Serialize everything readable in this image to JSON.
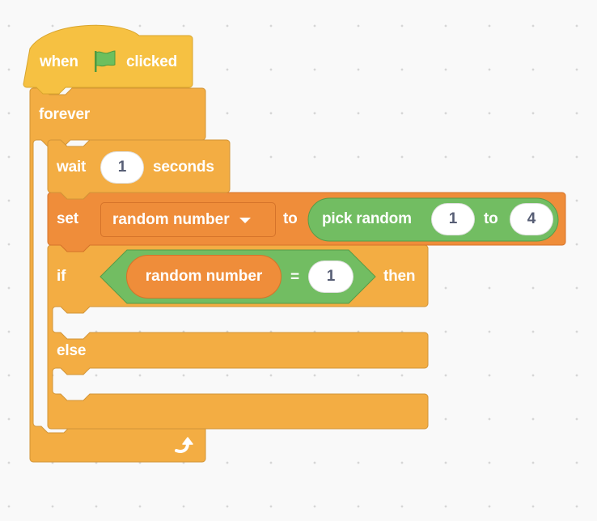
{
  "colors": {
    "events": "#f6c142",
    "events_border": "#d9a52c",
    "control": "#f3ad43",
    "control_border": "#d29538",
    "variables": "#ef8d3a",
    "variables_border": "#d5732a",
    "operators": "#72bd62",
    "operators_border": "#579c48",
    "input_text": "#575e75",
    "flag": "#6cbf5e"
  },
  "script": {
    "hat": {
      "label_before": "when",
      "icon": "green-flag-icon",
      "label_after": "clicked"
    },
    "forever": {
      "label": "forever",
      "end_icon": "repeat-arrow-icon"
    },
    "wait": {
      "label_before": "wait",
      "value": "1",
      "label_after": "seconds"
    },
    "set": {
      "label": "set",
      "variable": "random number",
      "to_label": "to",
      "reporter": {
        "label": "pick random",
        "from": "1",
        "to_label": "to",
        "to": "4"
      }
    },
    "if_else": {
      "if_label": "if",
      "condition": {
        "left_variable": "random number",
        "operator": "=",
        "right_value": "1"
      },
      "then_label": "then",
      "else_label": "else"
    }
  }
}
